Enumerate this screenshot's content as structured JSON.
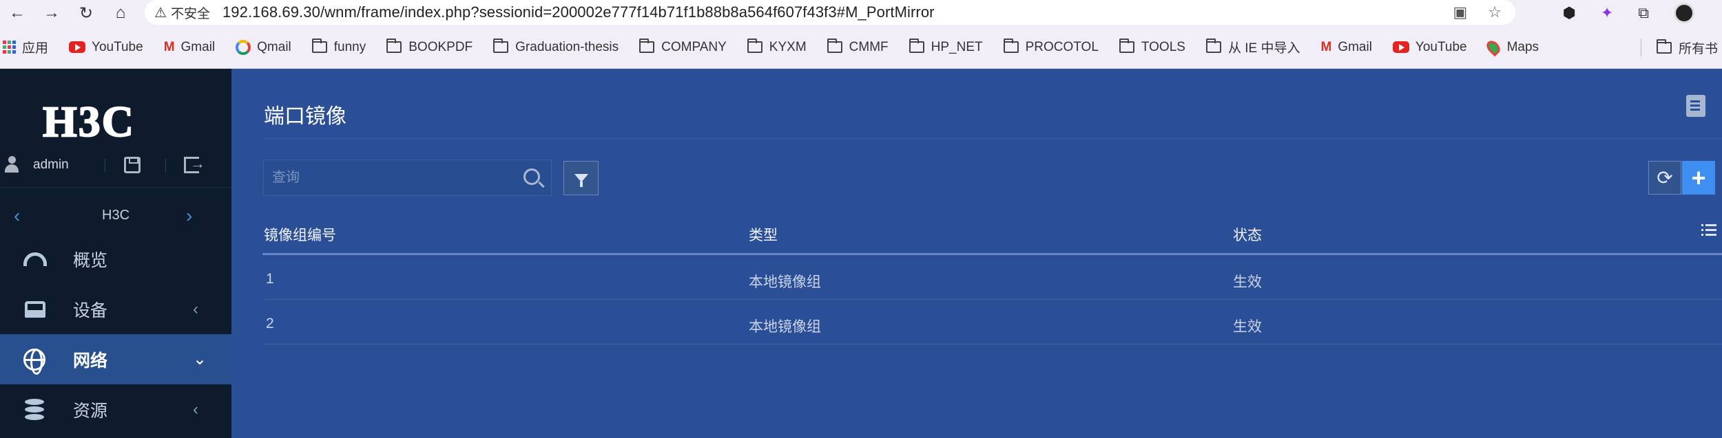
{
  "browser": {
    "security_label": "不安全",
    "url": "192.168.69.30/wnm/frame/index.php?sessionid=200002e777f14b71f1b88b8a564f607f43f3#M_PortMirror",
    "bookmarks": [
      {
        "type": "apps",
        "label": "应用"
      },
      {
        "type": "youtube",
        "label": "YouTube"
      },
      {
        "type": "gmail",
        "label": "Gmail"
      },
      {
        "type": "qmail",
        "label": "Qmail"
      },
      {
        "type": "folder",
        "label": "funny"
      },
      {
        "type": "folder",
        "label": "BOOKPDF"
      },
      {
        "type": "folder",
        "label": "Graduation-thesis"
      },
      {
        "type": "folder",
        "label": "COMPANY"
      },
      {
        "type": "folder",
        "label": "KYXM"
      },
      {
        "type": "folder",
        "label": "CMMF"
      },
      {
        "type": "folder",
        "label": "HP_NET"
      },
      {
        "type": "folder",
        "label": "PROCOTOL"
      },
      {
        "type": "folder",
        "label": "TOOLS"
      },
      {
        "type": "folder",
        "label": "从 IE 中导入"
      },
      {
        "type": "gmail",
        "label": "Gmail"
      },
      {
        "type": "youtube",
        "label": "YouTube"
      },
      {
        "type": "maps",
        "label": "Maps"
      }
    ],
    "all_bookmarks": "所有书"
  },
  "sidebar": {
    "logo": "H3C",
    "user": "admin",
    "device": "H3C",
    "menu": [
      {
        "label": "概览",
        "icon": "gauge-icon",
        "arrow": ""
      },
      {
        "label": "设备",
        "icon": "drive-icon",
        "arrow": "‹"
      },
      {
        "label": "网络",
        "icon": "globe-icon",
        "arrow": "⌄"
      },
      {
        "label": "资源",
        "icon": "database-icon",
        "arrow": "‹"
      }
    ]
  },
  "main": {
    "title": "端口镜像",
    "search_placeholder": "查询",
    "table": {
      "headers": [
        "镜像组编号",
        "类型",
        "状态"
      ],
      "rows": [
        [
          "1",
          "本地镜像组",
          "生效"
        ],
        [
          "2",
          "本地镜像组",
          "生效"
        ]
      ]
    }
  }
}
